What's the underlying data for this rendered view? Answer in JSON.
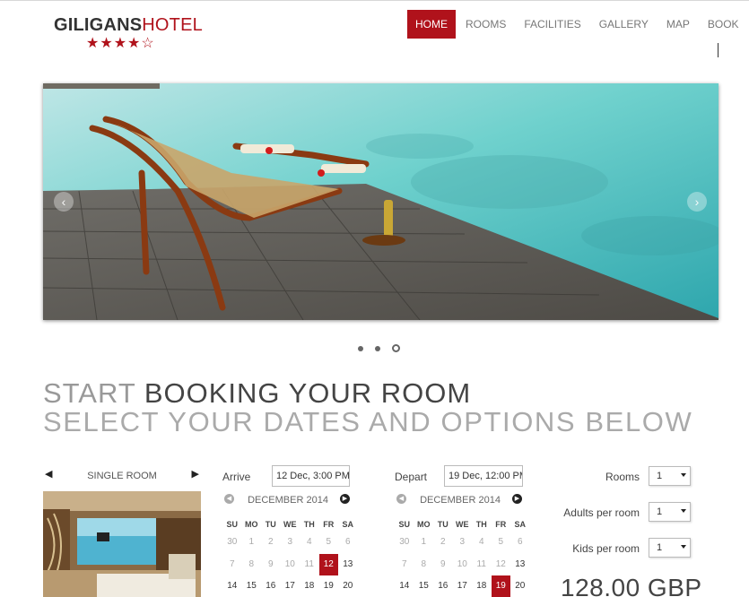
{
  "brand": {
    "name_dark": "GILIGANS",
    "name_accent": "HOTEL",
    "stars": "★★★★☆",
    "accent_color": "#b0121b"
  },
  "nav": {
    "items": [
      {
        "label": "HOME",
        "active": true
      },
      {
        "label": "ROOMS"
      },
      {
        "label": "FACILITIES"
      },
      {
        "label": "GALLERY"
      },
      {
        "label": "MAP"
      },
      {
        "label": "BOOK"
      }
    ]
  },
  "slider": {
    "prev_icon": "chevron-left-icon",
    "next_icon": "chevron-right-icon",
    "slide_count": 3,
    "active_slide": 3
  },
  "headline": {
    "line1_light": "START",
    "line1_dark": "BOOKING YOUR ROOM",
    "line2": "SELECT YOUR DATES AND OPTIONS BELOW"
  },
  "room": {
    "name": "SINGLE ROOM",
    "prev_icon": "caret-left-icon",
    "next_icon": "caret-right-icon"
  },
  "arrive": {
    "label": "Arrive",
    "value": "12 Dec, 3:00 PM",
    "month": "DECEMBER 2014",
    "weekdays": [
      "SU",
      "MO",
      "TU",
      "WE",
      "TH",
      "FR",
      "SA"
    ],
    "rows": [
      [
        "30",
        "1",
        "2",
        "3",
        "4",
        "5",
        "6"
      ],
      [
        "7",
        "8",
        "9",
        "10",
        "11",
        "12",
        "13"
      ],
      [
        "14",
        "15",
        "16",
        "17",
        "18",
        "19",
        "20"
      ]
    ],
    "selected": "12"
  },
  "depart": {
    "label": "Depart",
    "value": "19 Dec, 12:00 PM",
    "month": "DECEMBER 2014",
    "weekdays": [
      "SU",
      "MO",
      "TU",
      "WE",
      "TH",
      "FR",
      "SA"
    ],
    "rows": [
      [
        "30",
        "1",
        "2",
        "3",
        "4",
        "5",
        "6"
      ],
      [
        "7",
        "8",
        "9",
        "10",
        "11",
        "12",
        "13"
      ],
      [
        "14",
        "15",
        "16",
        "17",
        "18",
        "19",
        "20"
      ]
    ],
    "selected": "19"
  },
  "options": {
    "rooms": {
      "label": "Rooms",
      "value": "1"
    },
    "adults": {
      "label": "Adults per room",
      "value": "1"
    },
    "kids": {
      "label": "Kids per room",
      "value": "1"
    }
  },
  "price": "128.00 GBP"
}
